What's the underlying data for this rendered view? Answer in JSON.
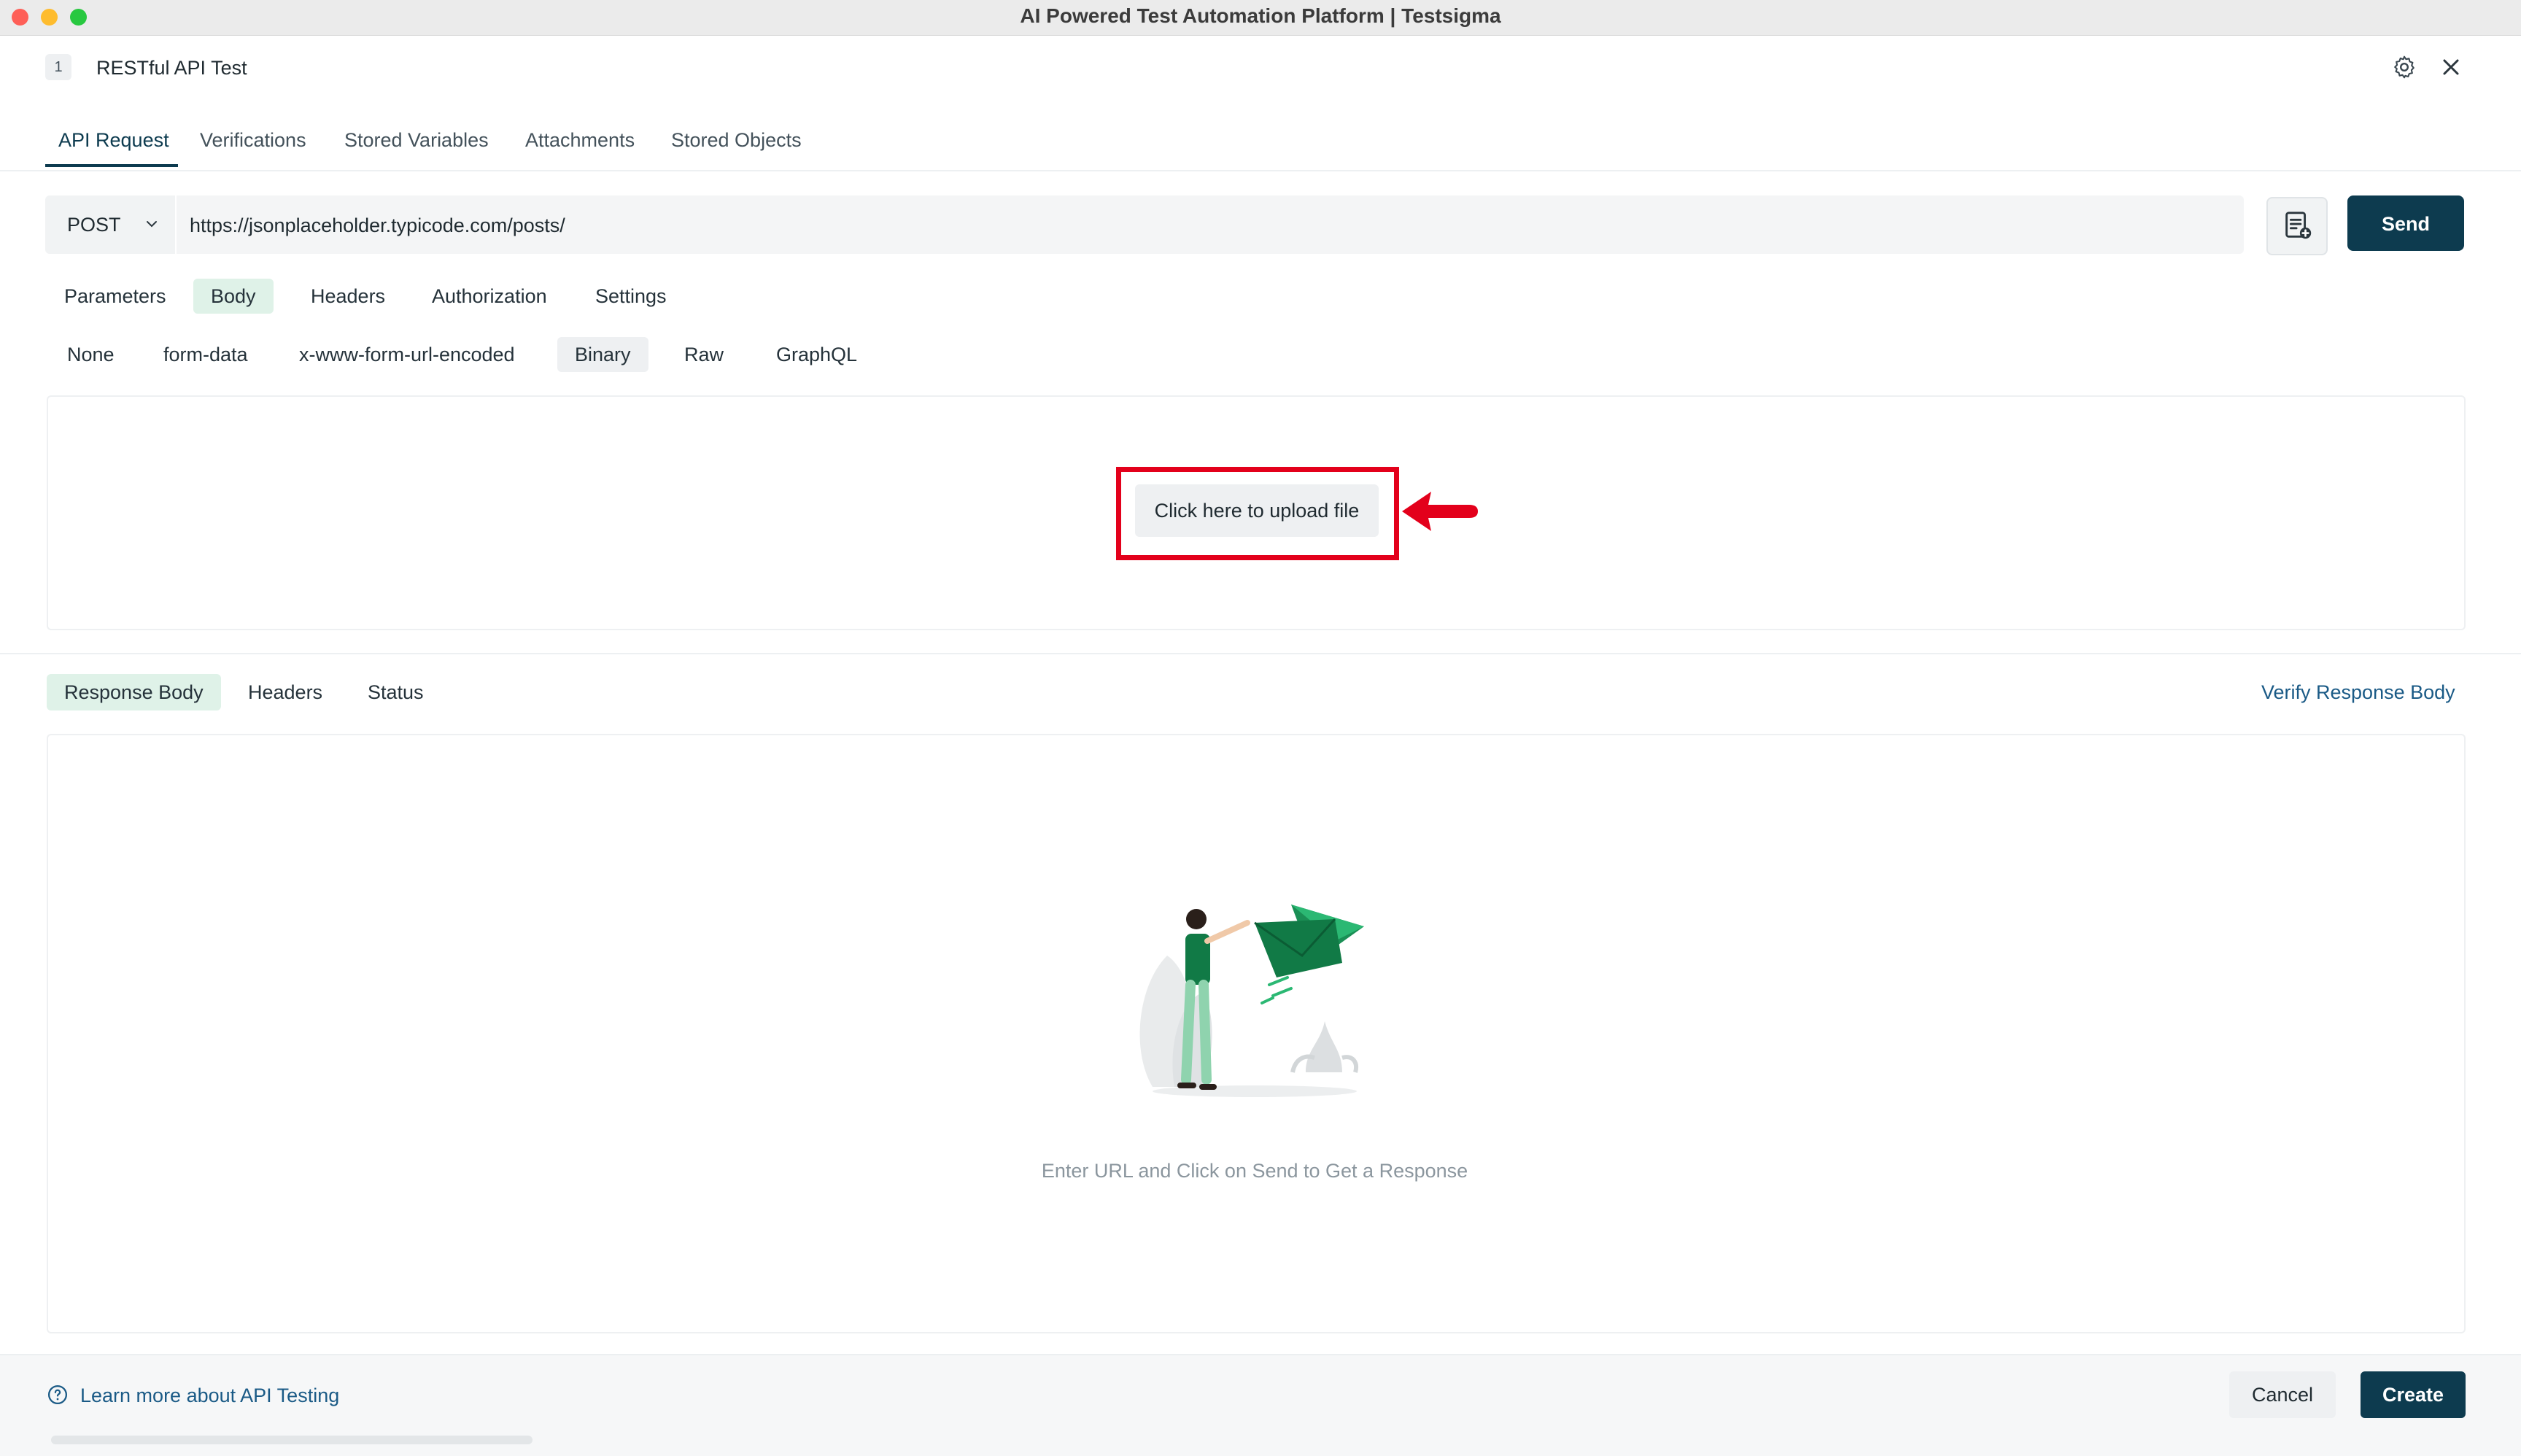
{
  "window": {
    "title": "AI Powered Test Automation Platform | Testsigma",
    "traffic_colors": {
      "close": "#fe5f57",
      "minimize": "#febc2e",
      "zoom": "#28c840"
    }
  },
  "header": {
    "step_number": "1",
    "step_title": "RESTful API Test",
    "settings_icon": "gear-icon",
    "close_icon": "close-icon"
  },
  "tabs": [
    {
      "label": "API Request",
      "active": true
    },
    {
      "label": "Verifications"
    },
    {
      "label": "Stored Variables"
    },
    {
      "label": "Attachments"
    },
    {
      "label": "Stored Objects"
    }
  ],
  "request": {
    "method": "POST",
    "url": "https://jsonplaceholder.typicode.com/posts/",
    "add_icon": "document-add-icon",
    "send_label": "Send"
  },
  "request_tabs": [
    {
      "label": "Parameters"
    },
    {
      "label": "Body",
      "active": true
    },
    {
      "label": "Headers"
    },
    {
      "label": "Authorization"
    },
    {
      "label": "Settings"
    }
  ],
  "body_types": [
    {
      "label": "None"
    },
    {
      "label": "form-data"
    },
    {
      "label": "x-www-form-url-encoded"
    },
    {
      "label": "Binary",
      "active": true
    },
    {
      "label": "Raw"
    },
    {
      "label": "GraphQL"
    }
  ],
  "upload": {
    "label": "Click here to upload file"
  },
  "response": {
    "tabs": [
      {
        "label": "Response Body",
        "active": true
      },
      {
        "label": "Headers"
      },
      {
        "label": "Status"
      }
    ],
    "verify_link": "Verify Response Body",
    "empty_message": "Enter URL and Click on Send to Get a Response"
  },
  "footer": {
    "help_link": "Learn more about API Testing",
    "cancel_label": "Cancel",
    "create_label": "Create"
  },
  "colors": {
    "primary": "#0d3b4f",
    "active_tab_bg": "#dff2e8",
    "link": "#1a5a86",
    "highlight": "#e3001b"
  }
}
